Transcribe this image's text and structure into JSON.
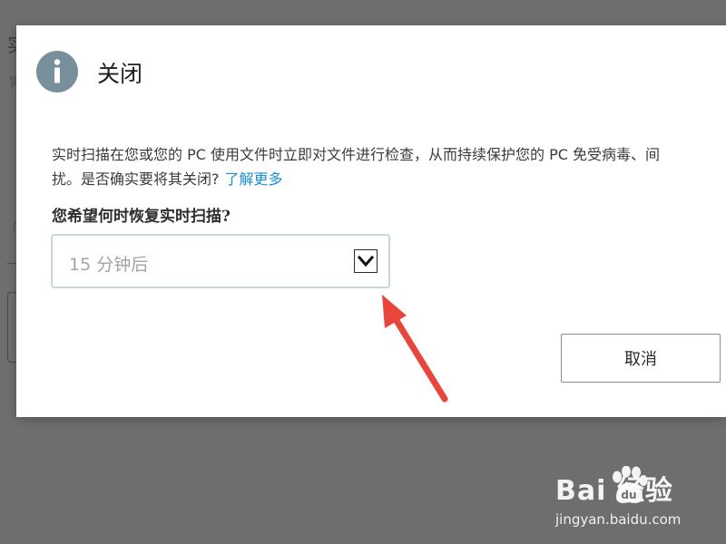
{
  "background": {
    "title_fragment": "实",
    "subtitle_fragment": "实",
    "tick_fragment": "门"
  },
  "dialog": {
    "icon": "info-icon",
    "title": "关闭",
    "description_line1": "实时扫描在您或您的 PC 使用文件时立即对文件进行检查，从而持续保护您的 PC 免受病毒、间",
    "description_line2": "扰。是否确实要将其关闭?",
    "learn_more_link": "了解更多",
    "question": "您希望何时恢复实时扫描?",
    "resume_select": {
      "selected_value": "15 分钟后",
      "chevron_icon": "chevron-down-icon"
    },
    "cancel_button": "取消"
  },
  "colors": {
    "overlay": "#6e6e6e",
    "icon_bg": "#78909c",
    "link": "#1a8fd0",
    "annotation_arrow": "#e8453c"
  },
  "watermark": {
    "logo_text": "Bai   经验",
    "url": "jingyan.baidu.com"
  }
}
